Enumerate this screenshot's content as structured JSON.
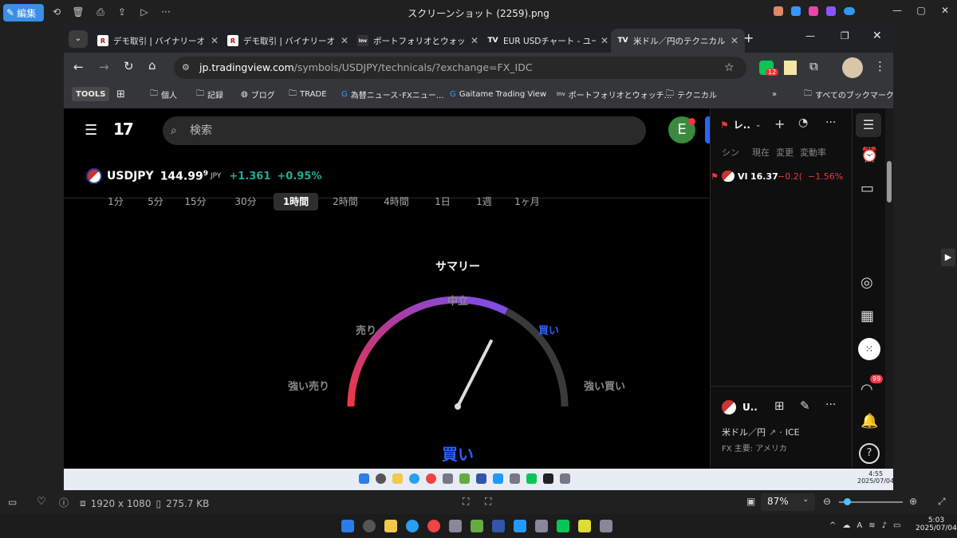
{
  "viewer": {
    "edit_label": "編集",
    "title": "スクリーンショット (2259).png",
    "image_size": "1920 x 1080",
    "file_size": "275.7 KB",
    "zoom": "87%"
  },
  "tabs": [
    {
      "label": "デモ取引 | バイナリーオプ",
      "icon": "R"
    },
    {
      "label": "デモ取引 | バイナリーオプ",
      "icon": "R"
    },
    {
      "label": "ポートフォリオとウォッチ・",
      "icon": "Inv"
    },
    {
      "label": "EUR USDチャート - ユー",
      "icon": "TV"
    },
    {
      "label": "米ドル／円のテクニカル",
      "icon": "TV"
    }
  ],
  "address": {
    "host": "jp.tradingview.com",
    "path": "/symbols/USDJPY/technicals/?exchange=FX_IDC"
  },
  "extensions": {
    "badge": "12"
  },
  "bookmarks": [
    {
      "label": "TOOLS"
    },
    {
      "label": "個人"
    },
    {
      "label": "記録"
    },
    {
      "label": "ブログ"
    },
    {
      "label": "TRADE"
    },
    {
      "label": "為替ニュース･FXニュー..."
    },
    {
      "label": "Gaitame Trading View"
    },
    {
      "label": "ポートフォリオとウォッチ..."
    },
    {
      "label": "テクニカル"
    },
    {
      "label": "すべてのブックマーク"
    }
  ],
  "tv": {
    "search_placeholder": "検索",
    "avatar_letter": "E",
    "symbol": "USDJPY",
    "price": "144.99",
    "price_sup": "9",
    "currency": "JPY",
    "change": "+1.361",
    "change_pct": "+0.95%",
    "intervals": [
      "1分",
      "5分",
      "15分",
      "30分",
      "1時間",
      "2時間",
      "4時間",
      "1日",
      "1週",
      "1ヶ月"
    ],
    "active_interval": "1時間",
    "gauge": {
      "title": "サマリー",
      "neutral": "中立",
      "sell": "売り",
      "buy": "買い",
      "strong_sell": "強い売り",
      "strong_buy": "強い買い",
      "result": "買い",
      "value": 0.65
    },
    "counts_header": {
      "sell": "売り",
      "neutral": "中立",
      "buy": "買い"
    }
  },
  "watchlist": {
    "title": "レ..",
    "columns": [
      "シン",
      "現在",
      "変更",
      "変動率"
    ],
    "rows": [
      {
        "symbol": "VI",
        "price": "16.37",
        "change": "−0.2(",
        "change_pct": "−1.56%"
      }
    ]
  },
  "details": {
    "symbol": "U..",
    "name": "米ドル／円",
    "exchange": "ICE",
    "meta": "FX 主要: アメリカ",
    "notif_badge": "99"
  },
  "taskbar_inner": {
    "time": "4:55",
    "date": "2025/07/04"
  },
  "taskbar": {
    "time": "5:03",
    "date": "2025/07/04"
  }
}
